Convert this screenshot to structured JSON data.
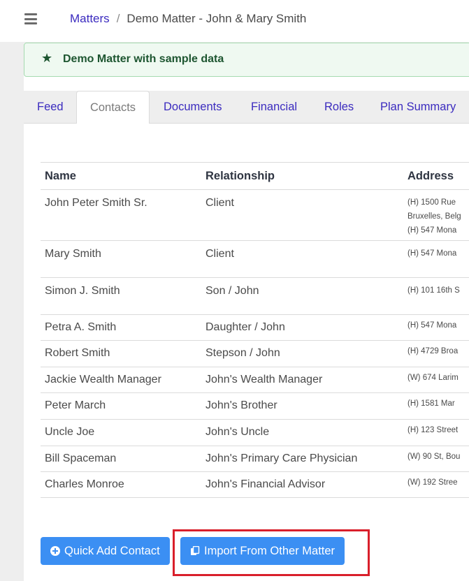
{
  "header": {
    "breadcrumb_root": "Matters",
    "breadcrumb_separator": "/",
    "breadcrumb_current": "Demo Matter - John & Mary Smith"
  },
  "banner": {
    "text": "Demo Matter with sample data",
    "icon": "star-icon"
  },
  "tabs": [
    {
      "label": "Feed",
      "active": false
    },
    {
      "label": "Contacts",
      "active": true
    },
    {
      "label": "Documents",
      "active": false
    },
    {
      "label": "Financial",
      "active": false
    },
    {
      "label": "Roles",
      "active": false
    },
    {
      "label": "Plan Summary",
      "active": false
    }
  ],
  "table": {
    "headers": {
      "name": "Name",
      "relationship": "Relationship",
      "address": "Address"
    },
    "rows": [
      {
        "name": "John Peter Smith Sr.",
        "relationship": "Client",
        "address": [
          "(H) 1500 Rue",
          "Bruxelles, Belg",
          "(H) 547 Mona"
        ]
      },
      {
        "name": "Mary Smith",
        "relationship": "Client",
        "address": [
          "",
          "(H) 547 Mona"
        ]
      },
      {
        "name": "Simon J. Smith",
        "relationship": "Son / John",
        "address": [
          "",
          "(H) 101 16th S"
        ]
      },
      {
        "name": "Petra A. Smith",
        "relationship": "Daughter / John",
        "address": [
          "(H) 547 Mona"
        ]
      },
      {
        "name": "Robert Smith",
        "relationship": "Stepson / John",
        "address": [
          "(H) 4729 Broa"
        ]
      },
      {
        "name": "Jackie Wealth Manager",
        "relationship": "John's Wealth Manager",
        "address": [
          "(W) 674 Larim"
        ]
      },
      {
        "name": "Peter March",
        "relationship": "John's Brother",
        "address": [
          "(H) 1581 Mar"
        ]
      },
      {
        "name": "Uncle Joe",
        "relationship": "John's Uncle",
        "address": [
          "(H) 123 Street"
        ]
      },
      {
        "name": "Bill Spaceman",
        "relationship": "John's Primary Care Physician",
        "address": [
          "(W) 90 St, Bou"
        ]
      },
      {
        "name": "Charles Monroe",
        "relationship": "John's Financial Advisor",
        "address": [
          "(W) 192 Stree"
        ]
      }
    ]
  },
  "actions": {
    "quick_add_label": "Quick Add Contact",
    "import_label": "Import From Other Matter"
  },
  "colors": {
    "link": "#3b2bbf",
    "button": "#3b8ff3",
    "banner_bg": "#eff9f1",
    "banner_text": "#1e5631",
    "highlight": "#d91f2b"
  }
}
